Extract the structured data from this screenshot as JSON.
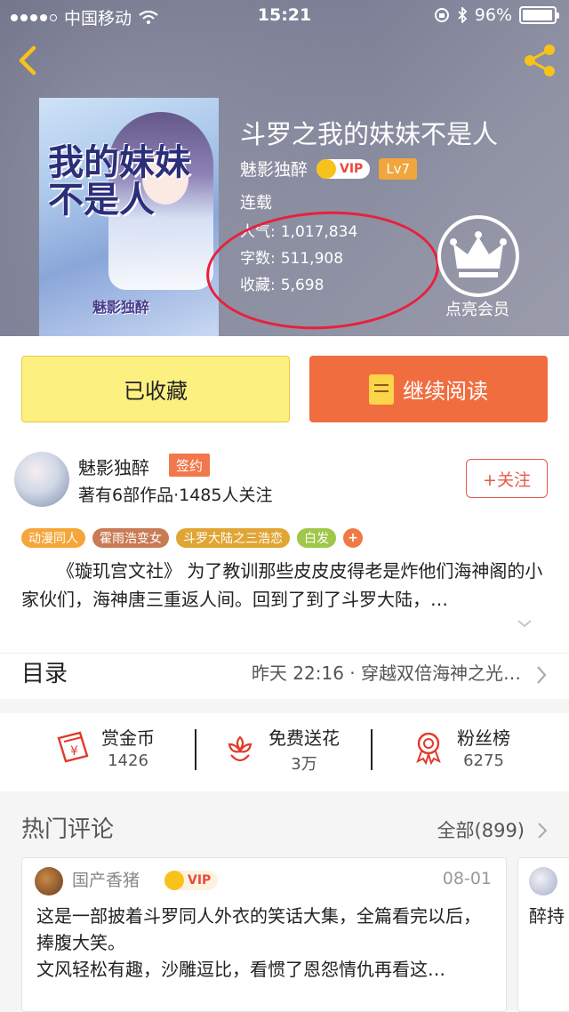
{
  "status_bar": {
    "carrier": "中国移动",
    "time": "15:21",
    "battery": "96%",
    "battery_level": 0.96
  },
  "book": {
    "title": "斗罗之我的妹妹不是人",
    "author": "魅影独醉",
    "vip": "VIP",
    "level": "Lv7",
    "status": "连载",
    "stats": [
      {
        "label": "人气:",
        "value": "1,017,834"
      },
      {
        "label": "字数:",
        "value": "511,908"
      },
      {
        "label": "收藏:",
        "value": "5,698"
      }
    ],
    "cover_title_art": "我的妹妹不是人",
    "cover_author": "魅影独醉"
  },
  "member": {
    "label": "点亮会员"
  },
  "actions": {
    "collected": "已收藏",
    "continue_reading": "继续阅读"
  },
  "author_card": {
    "name": "魅影独醉",
    "sign_tag": "签约",
    "meta": "著有6部作品·1485人关注",
    "follow": "+关注",
    "tags": [
      {
        "label": "动漫同人",
        "color": "#f5a63a"
      },
      {
        "label": "霍雨浩变女",
        "color": "#c97b55"
      },
      {
        "label": "斗罗大陆之三浩恋",
        "color": "#e0a534"
      },
      {
        "label": "白发",
        "color": "#9fc74a"
      },
      {
        "label": "+",
        "color": "#f07a45"
      }
    ],
    "description": "《璇玑宫文社》 为了教训那些皮皮皮得老是炸他们海神阁的小家伙们，海神唐三重返人间。回到了到了斗罗大陆，…"
  },
  "toc": {
    "title": "目录",
    "latest": "昨天 22:16 · 穿越双倍海神之光…"
  },
  "gifts": [
    {
      "label": "赏金币",
      "value": "1426",
      "icon": "gold-coin-envelope-icon"
    },
    {
      "label": "免费送花",
      "value": "3万",
      "icon": "flower-icon"
    },
    {
      "label": "粉丝榜",
      "value": "6275",
      "icon": "medal-icon"
    }
  ],
  "comments": {
    "title": "热门评论",
    "all": "全部(899)",
    "items": [
      {
        "user": "国产香猪",
        "vip": "VIP",
        "date": "08-01",
        "line1": "这是一部披着斗罗同人外衣的笑话大集，全篇看完以后，捧腹大笑。",
        "line2": "文风轻松有趣，沙雕逗比，看惯了恩怨情仇再看这…"
      }
    ],
    "partial_text": "醉持"
  },
  "colors": {
    "accent_orange": "#f06d3f",
    "collect_yellow": "#fcf081",
    "annotation_red": "#e8203c"
  }
}
